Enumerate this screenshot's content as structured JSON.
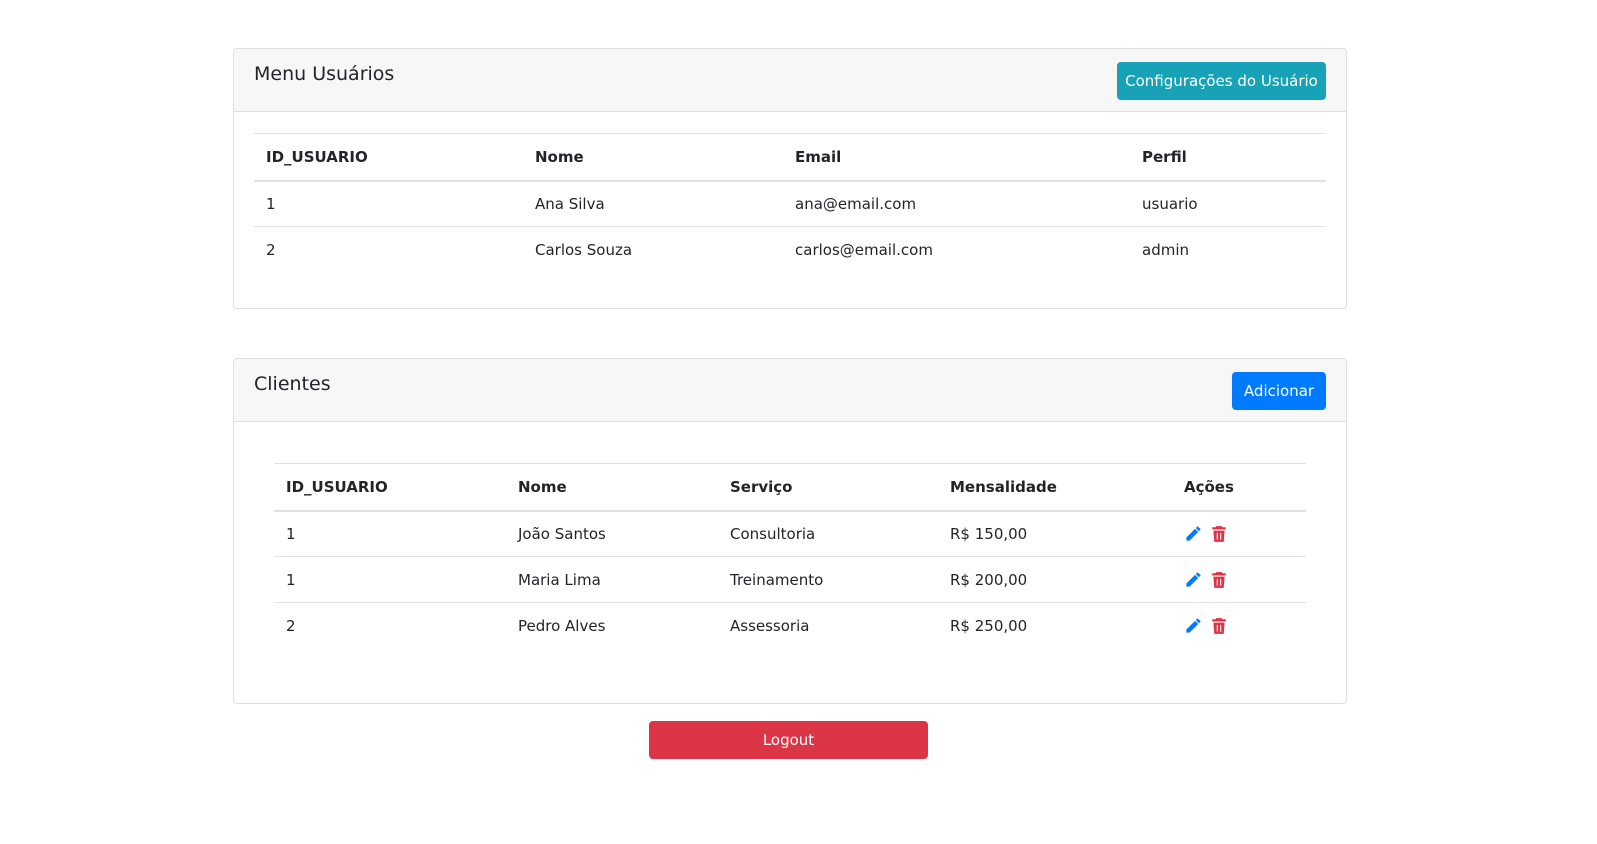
{
  "users_card": {
    "title": "Menu Usuários",
    "config_button": "Configurações do Usuário",
    "headers": [
      "ID_USUARIO",
      "Nome",
      "Email",
      "Perfil"
    ],
    "rows": [
      [
        "1",
        "Ana Silva",
        "ana@email.com",
        "usuario"
      ],
      [
        "2",
        "Carlos Souza",
        "carlos@email.com",
        "admin"
      ]
    ]
  },
  "clients_card": {
    "title": "Clientes",
    "add_button": "Adicionar",
    "headers": [
      "ID_USUARIO",
      "Nome",
      "Serviço",
      "Mensalidade",
      "Ações"
    ],
    "rows": [
      [
        "1",
        "João Santos",
        "Consultoria",
        "R$ 150,00"
      ],
      [
        "1",
        "Maria Lima",
        "Treinamento",
        "R$ 200,00"
      ],
      [
        "2",
        "Pedro Alves",
        "Assessoria",
        "R$ 250,00"
      ]
    ],
    "actions": {
      "edit_icon": "pencil-icon",
      "delete_icon": "trash-icon"
    }
  },
  "logout_button": "Logout",
  "colors": {
    "info": "#17a2b8",
    "primary": "#007bff",
    "danger": "#dc3545"
  }
}
